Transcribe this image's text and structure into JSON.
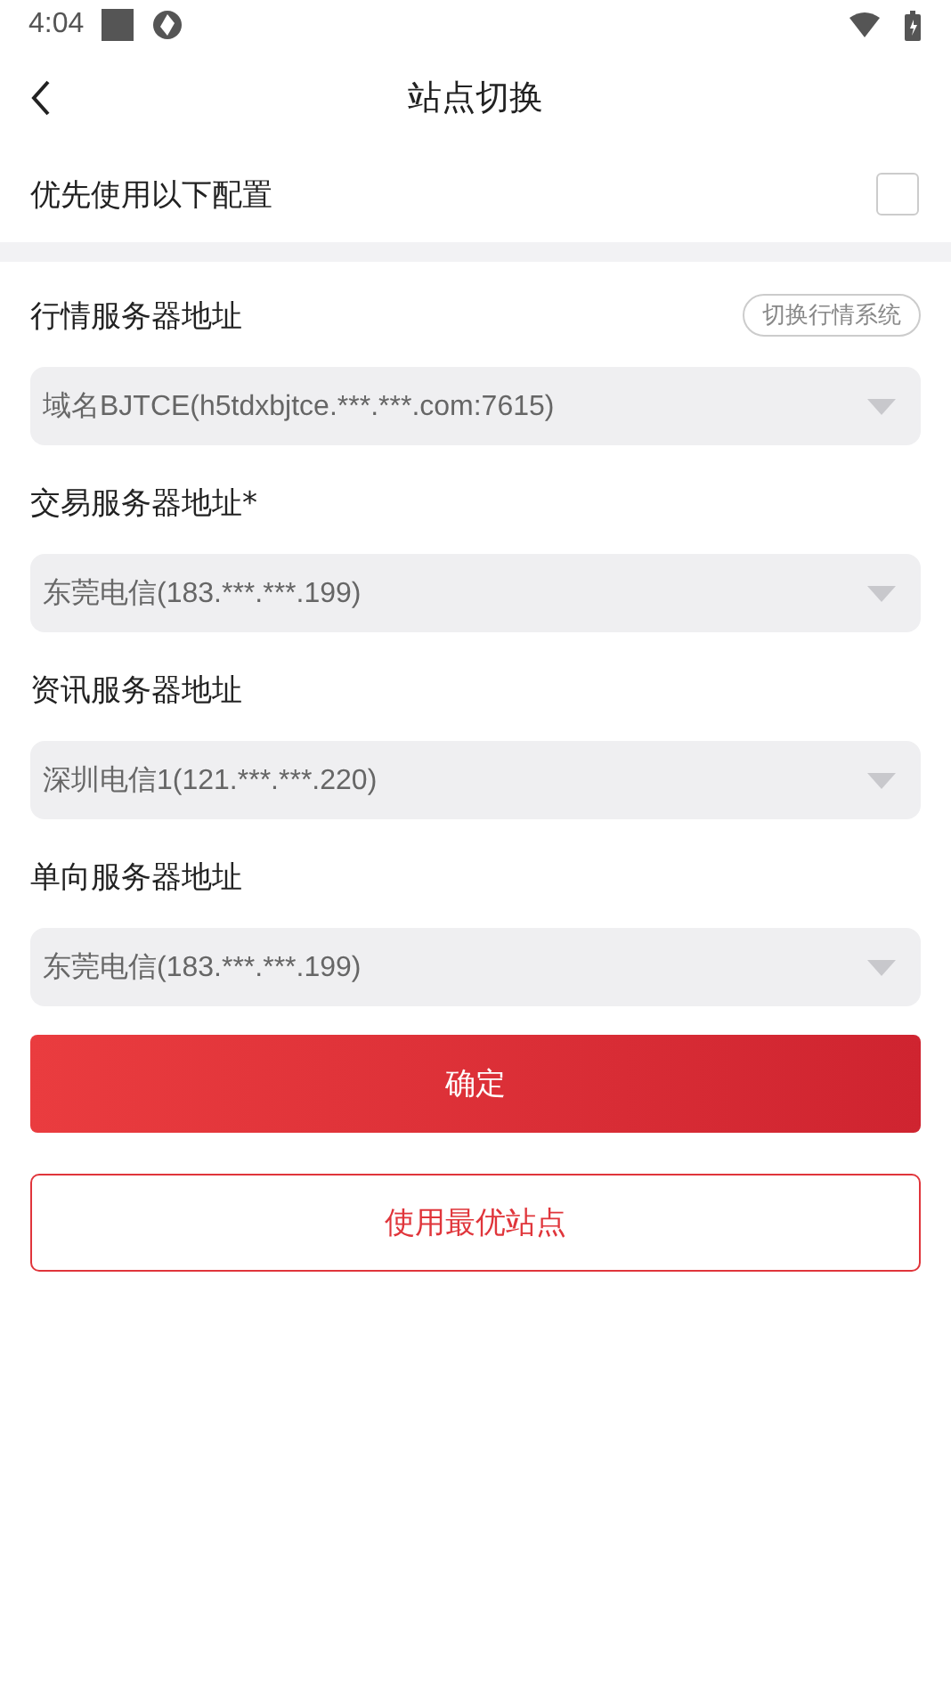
{
  "status_bar": {
    "time": "4:04"
  },
  "header": {
    "title": "站点切换"
  },
  "prefer_config": {
    "label": "优先使用以下配置",
    "checked": false
  },
  "servers": [
    {
      "label": "行情服务器地址",
      "value": "域名BJTCE(h5tdxbjtce.***.***.com:7615)",
      "action": "切换行情系统"
    },
    {
      "label": "交易服务器地址*",
      "value": "东莞电信(183.***.***.199)"
    },
    {
      "label": "资讯服务器地址",
      "value": "深圳电信1(121.***.***.220)"
    },
    {
      "label": "单向服务器地址",
      "value": "东莞电信(183.***.***.199)"
    }
  ],
  "buttons": {
    "confirm": "确定",
    "best": "使用最优站点"
  }
}
